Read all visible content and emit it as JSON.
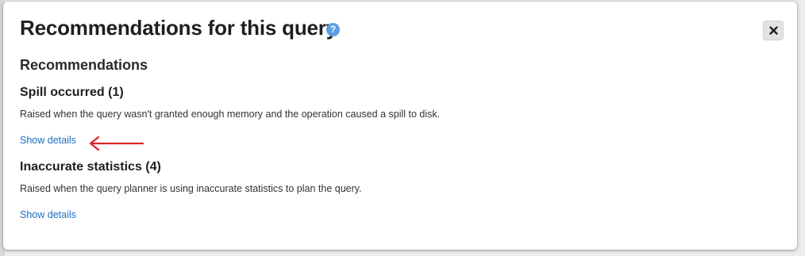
{
  "dialog": {
    "title": "Recommendations for this query",
    "help_icon": "question-circle-icon",
    "close_icon": "close-icon",
    "accent_color": "#5b9fe0"
  },
  "section": {
    "heading": "Recommendations"
  },
  "recommendations": [
    {
      "title": "Spill occurred (1)",
      "description": "Raised when the query wasn't granted enough memory and the operation caused a spill to disk.",
      "link": "Show details"
    },
    {
      "title": "Inaccurate statistics (4)",
      "description": "Raised when the query planner is using inaccurate statistics to plan the query.",
      "link": "Show details"
    }
  ],
  "annotation": {
    "type": "arrow",
    "color": "#d9262e",
    "points_to": "recommendations.0.link"
  }
}
